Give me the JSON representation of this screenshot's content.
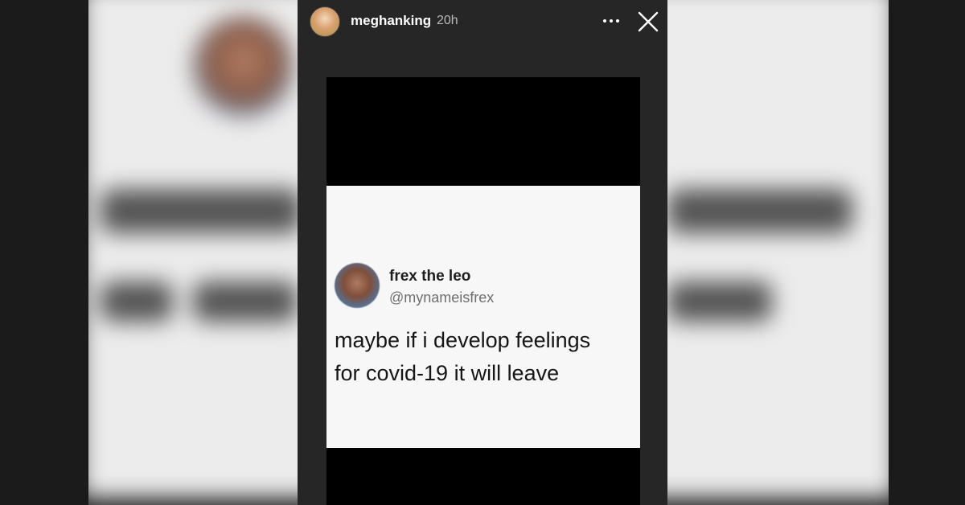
{
  "story": {
    "username": "meghanking",
    "time_ago": "20h",
    "more_icon": "more-horizontal-icon",
    "close_icon": "close-icon"
  },
  "tweet": {
    "display_name": "frex the leo",
    "handle": "@mynameisfrex",
    "text_line1": "maybe if i develop feelings",
    "text_line2": "for covid-19 it will leave"
  },
  "colors": {
    "page_bg": "#1b1b1b",
    "story_bg": "#262626",
    "media_bg": "#000000",
    "tweet_bg": "#f7f7f7"
  }
}
